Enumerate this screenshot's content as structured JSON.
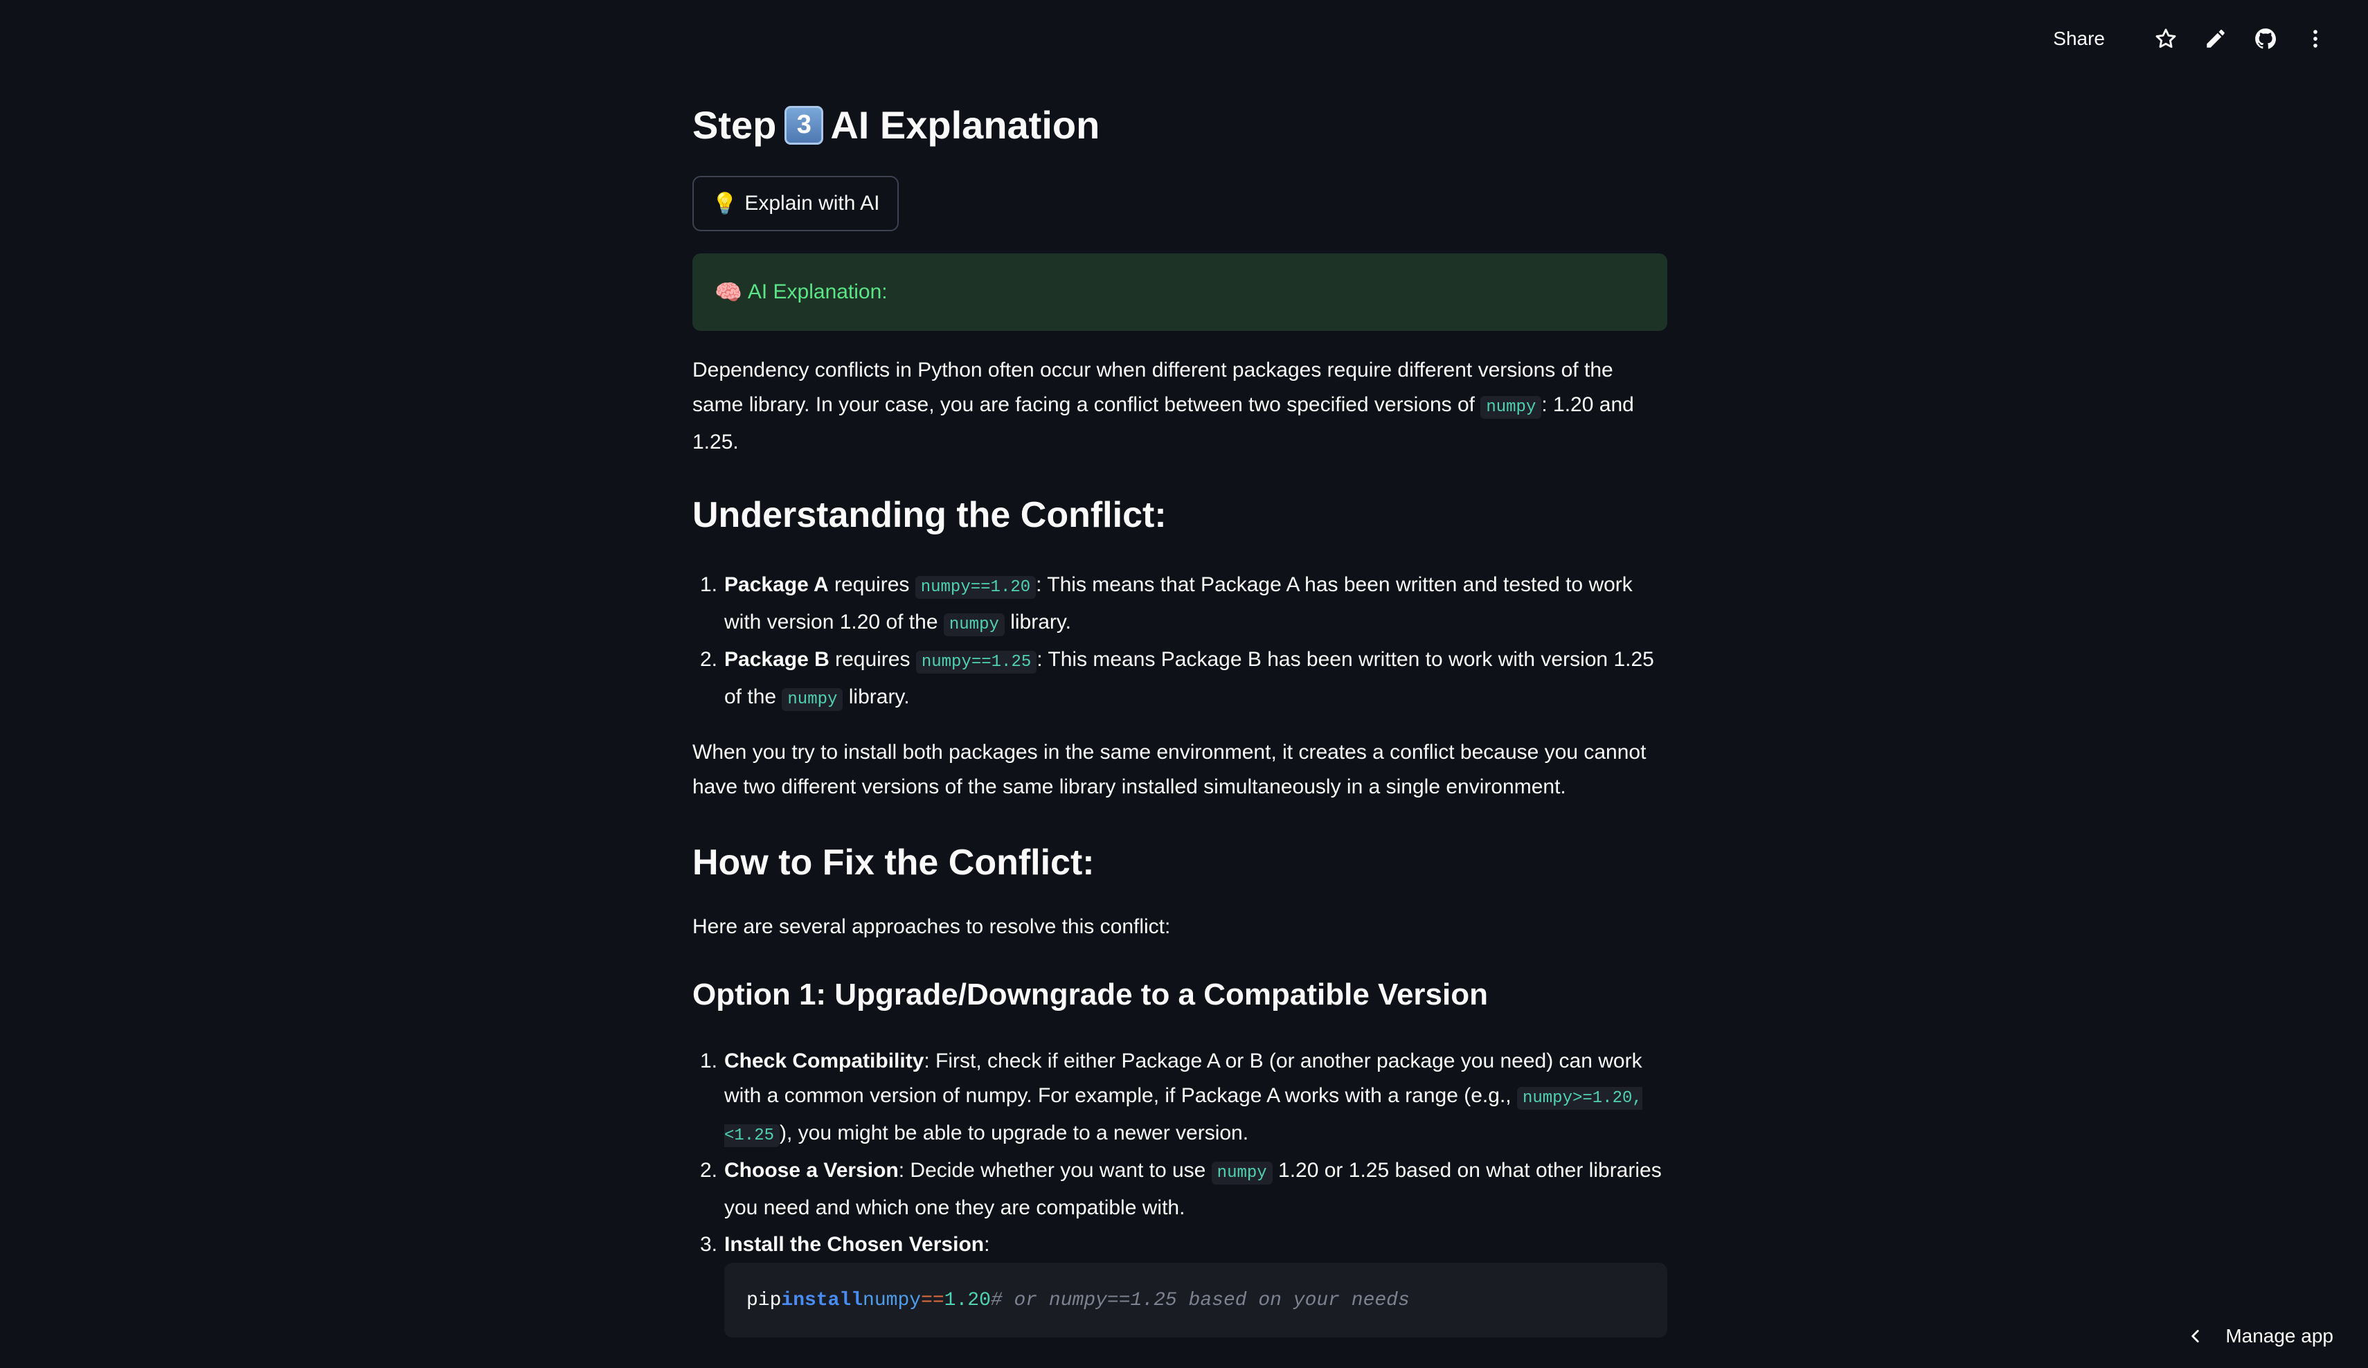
{
  "toolbar": {
    "share_label": "Share",
    "icons": [
      "star-icon",
      "pencil-icon",
      "github-icon",
      "more-vertical-icon"
    ]
  },
  "step": {
    "prefix": "Step",
    "keycap": "3",
    "title": "AI Explanation"
  },
  "explain_button": {
    "emoji": "💡",
    "label": "Explain with AI"
  },
  "alert": {
    "emoji": "🧠",
    "label": "AI Explanation:"
  },
  "intro": {
    "part1": "Dependency conflicts in Python often occur when different packages require different versions of the same library. In your case, you are facing a conflict between two specified versions of",
    "code": "numpy",
    "part2": ": 1.20 and 1.25."
  },
  "section1": {
    "heading": "Understanding the Conflict:",
    "items": [
      {
        "num": "1.",
        "bold": "Package A",
        "t1": " requires ",
        "code1": "numpy==1.20",
        "t2": ": This means that Package A has been written and tested to work with version 1.20 of the ",
        "code2": "numpy",
        "t3": " library."
      },
      {
        "num": "2.",
        "bold": "Package B",
        "t1": " requires ",
        "code1": "numpy==1.25",
        "t2": ": This means Package B has been written to work with version 1.25 of the ",
        "code2": "numpy",
        "t3": " library."
      }
    ],
    "paragraph": "When you try to install both packages in the same environment, it creates a conflict because you cannot have two different versions of the same library installed simultaneously in a single environment."
  },
  "section2": {
    "heading": "How to Fix the Conflict:",
    "intro": "Here are several approaches to resolve this conflict:"
  },
  "option1": {
    "heading": "Option 1: Upgrade/Downgrade to a Compatible Version",
    "items": [
      {
        "num": "1.",
        "bold": "Check Compatibility",
        "t1": ": First, check if either Package A or B (or another package you need) can work with a common version of numpy. For example, if Package A works with a range (e.g., ",
        "code1": "numpy>=1.20,<1.25",
        "t2": "), you might be able to upgrade to a newer version."
      },
      {
        "num": "2.",
        "bold": "Choose a Version",
        "t1": ": Decide whether you want to use ",
        "code1": "numpy",
        "t2": " 1.20 or 1.25 based on what other libraries you need and which one they are compatible with."
      },
      {
        "num": "3.",
        "bold": "Install the Chosen Version",
        "t1": ":"
      }
    ],
    "code": {
      "cmd": "pip",
      "kw": "install",
      "pkg": "numpy",
      "op": "==",
      "ver": "1.20",
      "comment": "# or numpy==1.25 based on your needs"
    }
  },
  "footer": {
    "manage_label": "Manage app"
  }
}
